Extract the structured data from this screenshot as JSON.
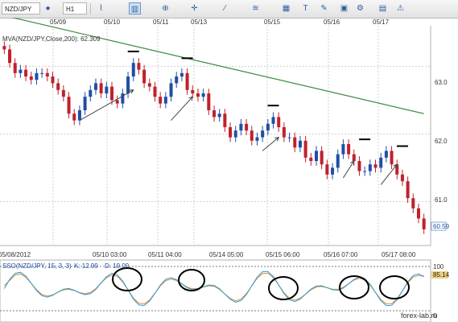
{
  "toolbar": {
    "symbol_value": "NZD/JPY",
    "interval_value": "H1",
    "icons": [
      "status-dot-icon",
      "line-chart-icon",
      "candle-chart-icon",
      "zoom-icon",
      "crosshair-icon",
      "draw-icon",
      "indicator-icon",
      "grid-icon",
      "text-icon",
      "ruler-icon",
      "screenshot-icon",
      "settings-icon",
      "calendar-icon",
      "alert-icon"
    ]
  },
  "chart_data": [
    {
      "type": "candlestick",
      "indicator_label": "MVA(NZD/JPY,Close,200): 62.309",
      "price_label": "60.59",
      "y_axis_ticks": [
        "63.0",
        "62.0",
        "61.0"
      ],
      "ylim": [
        60.35,
        63.6
      ],
      "top_date_ticks": [
        "05/09",
        "05/10",
        "05/11",
        "05/13",
        "05/15",
        "05/16",
        "05/17"
      ],
      "bottom_time_ticks": [
        "05/08/2012",
        "05/10 03:00",
        "05/11 04:00",
        "05/14 05:00",
        "05/15 06:00",
        "05/16 07:00",
        "05/17 08:00"
      ],
      "colors": {
        "up": "#1f4fa6",
        "down": "#c0212c",
        "ma": "#3b8a3b",
        "stoch_k": "#2e9bcf",
        "stoch_d": "#d98a3a",
        "price_tag": "#35b8c8"
      },
      "candles_close": [
        63.25,
        63.05,
        62.9,
        62.95,
        62.85,
        62.8,
        62.9,
        62.9,
        62.85,
        62.75,
        62.65,
        62.55,
        62.3,
        62.2,
        62.35,
        62.55,
        62.65,
        62.75,
        62.6,
        62.7,
        62.5,
        62.45,
        62.6,
        62.85,
        63.05,
        62.95,
        62.75,
        62.7,
        62.55,
        62.45,
        62.55,
        62.75,
        62.85,
        62.9,
        62.65,
        62.6,
        62.55,
        62.6,
        62.35,
        62.25,
        62.3,
        62.1,
        61.95,
        62.05,
        62.15,
        62.05,
        61.9,
        61.95,
        62.05,
        62.15,
        62.25,
        62.1,
        61.95,
        61.95,
        61.8,
        61.9,
        61.65,
        61.6,
        61.75,
        61.55,
        61.4,
        61.5,
        61.7,
        61.85,
        61.7,
        61.6,
        61.45,
        61.45,
        61.55,
        61.5,
        61.65,
        61.75,
        61.55,
        61.4,
        61.3,
        61.05,
        60.9,
        60.75,
        60.59
      ],
      "moving_average": [
        {
          "x": 0,
          "y": 63.75
        },
        {
          "x": 78,
          "y": 62.3
        }
      ],
      "stochastic": {
        "label": "SSO(NZD/JPY, 15, 3, 3)",
        "k_value": "K: 12.99",
        "d_value": "D: 19.09",
        "upper_level": "85.14",
        "scale_top": "100",
        "scale_bottom": "0"
      }
    }
  ],
  "footer": {
    "watermark": "forex-lab.ru"
  }
}
